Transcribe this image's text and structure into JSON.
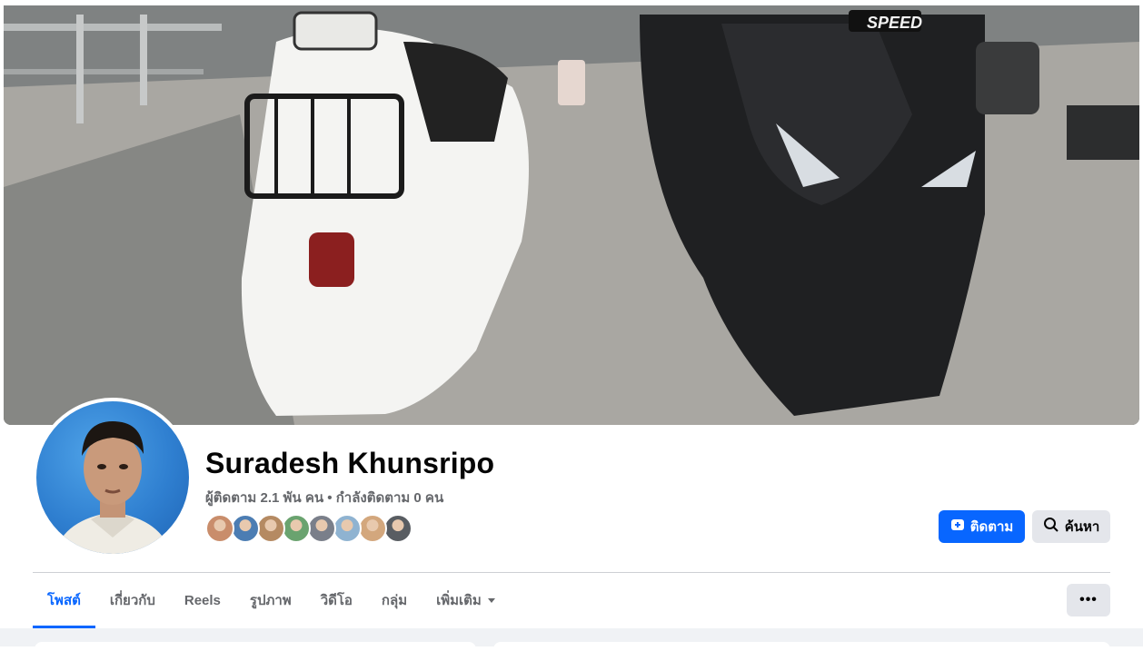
{
  "profile": {
    "name": "Suradesh Khunsripo",
    "stats": "ผู้ติดตาม 2.1 พัน คน • กำลังติดตาม 0 คน",
    "friend_avatar_colors": [
      "#c98d6b",
      "#4c7db3",
      "#b58a62",
      "#6aa36f",
      "#7a7f8a",
      "#8fb3d1",
      "#d3a77d",
      "#595d62"
    ]
  },
  "cover": {
    "speed_decal": "SPEED"
  },
  "actions": {
    "follow_label": "ติดตาม",
    "search_label": "ค้นหา"
  },
  "tabs": [
    {
      "label": "โพสต์",
      "active": true
    },
    {
      "label": "เกี่ยวกับ"
    },
    {
      "label": "Reels"
    },
    {
      "label": "รูปภาพ"
    },
    {
      "label": "วิดีโอ"
    },
    {
      "label": "กลุ่ม"
    },
    {
      "label": "เพิ่มเติม"
    }
  ],
  "more_button_label": "•••",
  "colors": {
    "accent": "#0866ff",
    "secondary_button": "#e4e6eb",
    "muted_text": "#65676b"
  }
}
